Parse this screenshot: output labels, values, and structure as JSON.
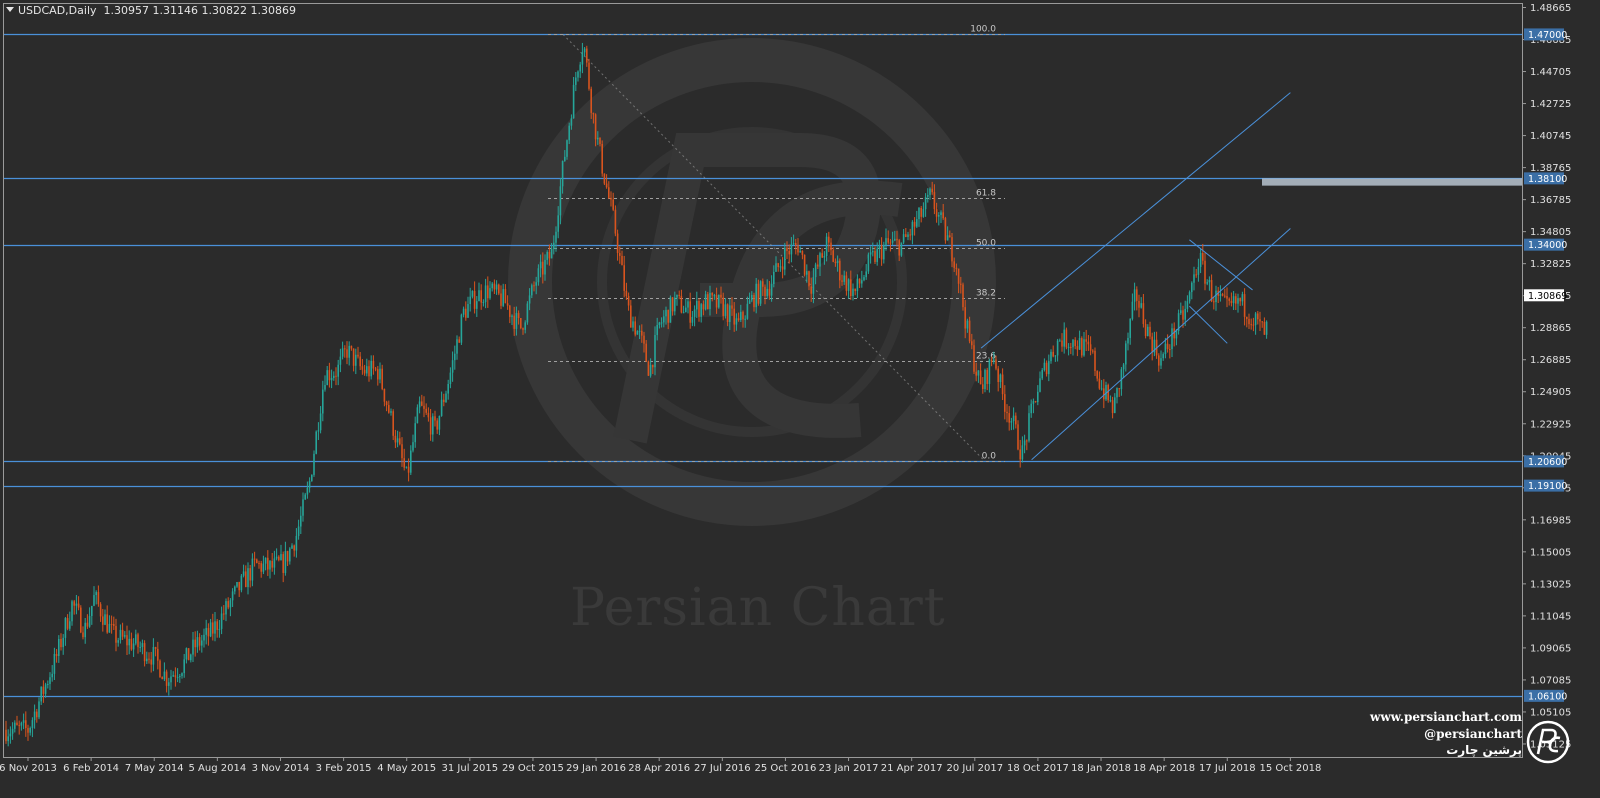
{
  "chart_header": {
    "symbol": "USDCAD,Daily",
    "ohlc": "1.30957 1.31146 1.30822 1.30869"
  },
  "watermark": "Persian Chart",
  "brand": {
    "url": "www.persianchart.com",
    "handle": "@persianchart",
    "name_fa": "پرشین چارت"
  },
  "colors": {
    "background": "#2b2b2b",
    "bull_candle": "#26a69a",
    "bear_candle": "#d9541e",
    "level_line": "#4a90d9",
    "price_tag": "#3b6fa6",
    "fib_line": "#a0a0a0",
    "zone": "#b8c4d0"
  },
  "chart_data": {
    "type": "candlestick",
    "symbol": "USDCAD",
    "timeframe": "Daily",
    "last_price": 1.30869,
    "ylim": [
      1.0222,
      1.4981
    ],
    "x_ticks": [
      "6 Nov 2013",
      "6 Feb 2014",
      "7 May 2014",
      "5 Aug 2014",
      "3 Nov 2014",
      "3 Feb 2015",
      "4 May 2015",
      "31 Jul 2015",
      "29 Oct 2015",
      "29 Jan 2016",
      "28 Apr 2016",
      "27 Jul 2016",
      "25 Oct 2016",
      "23 Jan 2017",
      "21 Apr 2017",
      "20 Jul 2017",
      "18 Oct 2017",
      "18 Jan 2018",
      "18 Apr 2018",
      "17 Jul 2018",
      "15 Oct 2018"
    ],
    "y_ticks": [
      "1.48665",
      "1.46685",
      "1.44705",
      "1.42725",
      "1.40745",
      "1.38765",
      "1.36785",
      "1.34805",
      "1.32825",
      "1.30845",
      "1.28865",
      "1.26885",
      "1.24905",
      "1.22925",
      "1.20945",
      "1.18965",
      "1.16985",
      "1.15005",
      "1.13025",
      "1.11045",
      "1.09065",
      "1.07085",
      "1.05105",
      "1.03125"
    ],
    "horizontal_levels": [
      {
        "price": 1.47,
        "label": "1.47000"
      },
      {
        "price": 1.381,
        "label": "1.38100"
      },
      {
        "price": 1.34,
        "label": "1.34000"
      },
      {
        "price": 1.206,
        "label": "1.20600"
      },
      {
        "price": 1.191,
        "label": "1.19100"
      },
      {
        "price": 1.061,
        "label": "1.06100"
      }
    ],
    "fibonacci": {
      "high": 1.47,
      "low": 1.206,
      "start_date_index": 8,
      "end_date_index": 16,
      "levels": [
        {
          "ratio": "100.0",
          "price": 1.47
        },
        {
          "ratio": "61.8",
          "price": 1.3691
        },
        {
          "ratio": "50.0",
          "price": 1.338
        },
        {
          "ratio": "38.2",
          "price": 1.3069
        },
        {
          "ratio": "23.6",
          "price": 1.2683
        },
        {
          "ratio": "0.0",
          "price": 1.206
        }
      ]
    },
    "supply_zone": {
      "high": 1.381,
      "low": 1.3765
    },
    "ascending_channel": {
      "upper": [
        {
          "x": 15.1,
          "price": 1.276
        },
        {
          "x": 20.0,
          "price": 1.434
        }
      ],
      "lower": [
        {
          "x": 15.9,
          "price": 1.207
        },
        {
          "x": 20.0,
          "price": 1.35
        }
      ]
    },
    "descending_flag": {
      "upper": [
        {
          "x": 18.4,
          "price": 1.343
        },
        {
          "x": 19.4,
          "price": 1.312
        }
      ],
      "lower": [
        {
          "x": 18.4,
          "price": 1.302
        },
        {
          "x": 19.0,
          "price": 1.279
        }
      ]
    },
    "price_path": [
      [
        0.0,
        1.04
      ],
      [
        0.2,
        1.06
      ],
      [
        0.45,
        1.085
      ],
      [
        0.7,
        1.118
      ],
      [
        0.9,
        1.102
      ],
      [
        1.05,
        1.122
      ],
      [
        1.35,
        1.098
      ],
      [
        1.7,
        1.093
      ],
      [
        2.0,
        1.085
      ],
      [
        2.2,
        1.072
      ],
      [
        2.45,
        1.08
      ],
      [
        2.65,
        1.092
      ],
      [
        2.9,
        1.1
      ],
      [
        3.1,
        1.112
      ],
      [
        3.35,
        1.128
      ],
      [
        3.6,
        1.142
      ],
      [
        3.85,
        1.14
      ],
      [
        4.05,
        1.143
      ],
      [
        4.25,
        1.16
      ],
      [
        4.45,
        1.19
      ],
      [
        4.7,
        1.26
      ],
      [
        4.9,
        1.262
      ],
      [
        5.05,
        1.275
      ],
      [
        5.3,
        1.262
      ],
      [
        5.55,
        1.262
      ],
      [
        5.8,
        1.225
      ],
      [
        6.0,
        1.195
      ],
      [
        6.2,
        1.24
      ],
      [
        6.45,
        1.225
      ],
      [
        6.7,
        1.262
      ],
      [
        6.9,
        1.298
      ],
      [
        7.1,
        1.308
      ],
      [
        7.3,
        1.312
      ],
      [
        7.55,
        1.305
      ],
      [
        7.8,
        1.288
      ],
      [
        8.05,
        1.318
      ],
      [
        8.3,
        1.335
      ],
      [
        8.5,
        1.395
      ],
      [
        8.7,
        1.45
      ],
      [
        8.8,
        1.466
      ],
      [
        8.95,
        1.42
      ],
      [
        9.1,
        1.388
      ],
      [
        9.3,
        1.35
      ],
      [
        9.5,
        1.3
      ],
      [
        9.7,
        1.282
      ],
      [
        9.85,
        1.262
      ],
      [
        10.0,
        1.29
      ],
      [
        10.25,
        1.305
      ],
      [
        10.5,
        1.298
      ],
      [
        10.75,
        1.305
      ],
      [
        11.0,
        1.302
      ],
      [
        11.25,
        1.29
      ],
      [
        11.5,
        1.308
      ],
      [
        11.75,
        1.315
      ],
      [
        12.0,
        1.335
      ],
      [
        12.2,
        1.34
      ],
      [
        12.4,
        1.315
      ],
      [
        12.65,
        1.34
      ],
      [
        12.9,
        1.32
      ],
      [
        13.1,
        1.31
      ],
      [
        13.35,
        1.33
      ],
      [
        13.6,
        1.34
      ],
      [
        13.85,
        1.34
      ],
      [
        14.1,
        1.355
      ],
      [
        14.3,
        1.37
      ],
      [
        14.5,
        1.35
      ],
      [
        14.7,
        1.33
      ],
      [
        14.9,
        1.282
      ],
      [
        15.1,
        1.25
      ],
      [
        15.3,
        1.272
      ],
      [
        15.45,
        1.245
      ],
      [
        15.6,
        1.23
      ],
      [
        15.75,
        1.21
      ],
      [
        15.95,
        1.245
      ],
      [
        16.15,
        1.268
      ],
      [
        16.35,
        1.282
      ],
      [
        16.6,
        1.28
      ],
      [
        16.85,
        1.272
      ],
      [
        17.0,
        1.252
      ],
      [
        17.2,
        1.238
      ],
      [
        17.35,
        1.265
      ],
      [
        17.55,
        1.31
      ],
      [
        17.75,
        1.285
      ],
      [
        17.95,
        1.268
      ],
      [
        18.15,
        1.285
      ],
      [
        18.35,
        1.3
      ],
      [
        18.55,
        1.332
      ],
      [
        18.75,
        1.31
      ],
      [
        19.0,
        1.3
      ],
      [
        19.2,
        1.305
      ],
      [
        19.4,
        1.295
      ],
      [
        19.6,
        1.285
      ],
      [
        19.8,
        1.302
      ],
      [
        19.95,
        1.309
      ]
    ]
  }
}
